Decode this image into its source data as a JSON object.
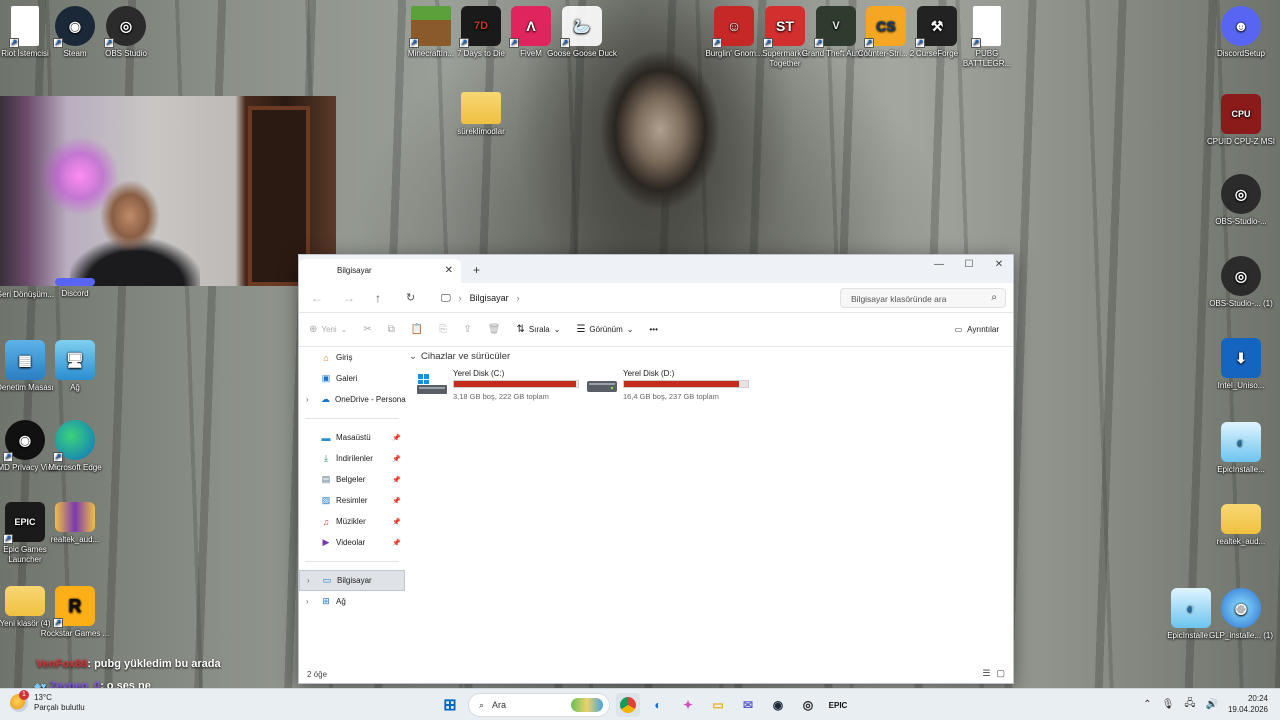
{
  "desktop_icons_top": [
    {
      "label": "Riot İstemcisi",
      "icon": "document-icon"
    },
    {
      "label": "Steam",
      "icon": "steam-icon"
    },
    {
      "label": "OBS Studio",
      "icon": "obs-icon"
    },
    {
      "label": "MinecraftIn...",
      "icon": "minecraft-icon"
    },
    {
      "label": "7 Days to Die",
      "icon": "7days-icon"
    },
    {
      "label": "FiveM",
      "icon": "fivem-icon"
    },
    {
      "label": "Goose Goose Duck",
      "icon": "goose-icon"
    },
    {
      "label": "Burglin' Gnom...",
      "icon": "burglin-icon"
    },
    {
      "label": "Supermarket Together",
      "icon": "supermarket-icon"
    },
    {
      "label": "Grand Theft Auto V",
      "icon": "gta-icon"
    },
    {
      "label": "Counter-Stri... 2",
      "icon": "cs2-icon"
    },
    {
      "label": "CurseForge",
      "icon": "curseforge-icon"
    },
    {
      "label": "PUBG BATTLEGR...",
      "icon": "document-icon"
    },
    {
      "label": "DiscordSetup",
      "icon": "discord-icon"
    }
  ],
  "desktop_icons_left": [
    {
      "label": "Geri Dönüşüm...",
      "icon": "recycle-bin-icon"
    },
    {
      "label": "Discord",
      "icon": "discord-icon"
    },
    {
      "label": "Denetim Masası",
      "icon": "control-panel-icon"
    },
    {
      "label": "Ağ",
      "icon": "network-icon"
    },
    {
      "label": "AMD Privacy View",
      "icon": "amd-privacy-icon"
    },
    {
      "label": "Microsoft Edge",
      "icon": "edge-icon"
    },
    {
      "label": "Epic Games Launcher",
      "icon": "epic-icon"
    },
    {
      "label": "realtek_aud...",
      "icon": "folder-icon"
    },
    {
      "label": "Yeni klasör (4)",
      "icon": "folder-icon"
    },
    {
      "label": "Rockstar Games ...",
      "icon": "rockstar-icon"
    }
  ],
  "desktop_icons_right": [
    {
      "label": "CPUID CPU-Z MSI",
      "icon": "cpuz-icon"
    },
    {
      "label": "OBS-Studio-...",
      "icon": "obs-icon"
    },
    {
      "label": "OBS-Studio-... (1)",
      "icon": "obs-icon"
    },
    {
      "label": "Intel_Uniso...",
      "icon": "download-icon"
    },
    {
      "label": "EpicInstalle...",
      "icon": "installer-icon"
    },
    {
      "label": "realtek_aud...",
      "icon": "folder-icon"
    },
    {
      "label": "EpicInstalle...",
      "icon": "installer-icon"
    },
    {
      "label": "GLP_installe... (1)",
      "icon": "installer-icon"
    }
  ],
  "desktop_folder_center": {
    "label": "süreklimodlar"
  },
  "explorer": {
    "tab_title": "Bilgisayar",
    "breadcrumb": "Bilgisayar",
    "search_placeholder": "Bilgisayar klasöründe ara",
    "toolbar": {
      "new": "Yeni",
      "sort": "Sırala",
      "view": "Görünüm",
      "more": "•••",
      "details": "Ayrıntılar"
    },
    "nav": {
      "home": "Giriş",
      "gallery": "Galeri",
      "onedrive": "OneDrive - Persona",
      "desktop": "Masaüstü",
      "downloads": "İndirilenler",
      "documents": "Belgeler",
      "pictures": "Resimler",
      "music": "Müzikler",
      "videos": "Videolar",
      "computer": "Bilgisayar",
      "network": "Ağ"
    },
    "section_title": "Cihazlar ve sürücüler",
    "drives": [
      {
        "name": "Yerel Disk (C:)",
        "free_text": "3,18 GB boş, 222 GB toplam",
        "used_fraction": 0.986
      },
      {
        "name": "Yerel Disk (D:)",
        "free_text": "16,4 GB boş, 237 GB toplam",
        "used_fraction": 0.931
      }
    ],
    "status": "2 öğe"
  },
  "chat": [
    {
      "user": "VenFox86",
      "message": ": pubg yükledim bu arada"
    },
    {
      "user": "Zeynep_0",
      "message": ": o ses ne"
    }
  ],
  "taskbar": {
    "weather_temp": "13°C",
    "weather_desc": "Parçalı bulutlu",
    "weather_badge": "1",
    "search_placeholder": "Ara",
    "time": "20:24",
    "date": "19.04.2026"
  },
  "colors": {
    "drive_fill": "#c42b1c",
    "taskbar_bg": "#e9eef3",
    "accent": "#0067c0"
  }
}
